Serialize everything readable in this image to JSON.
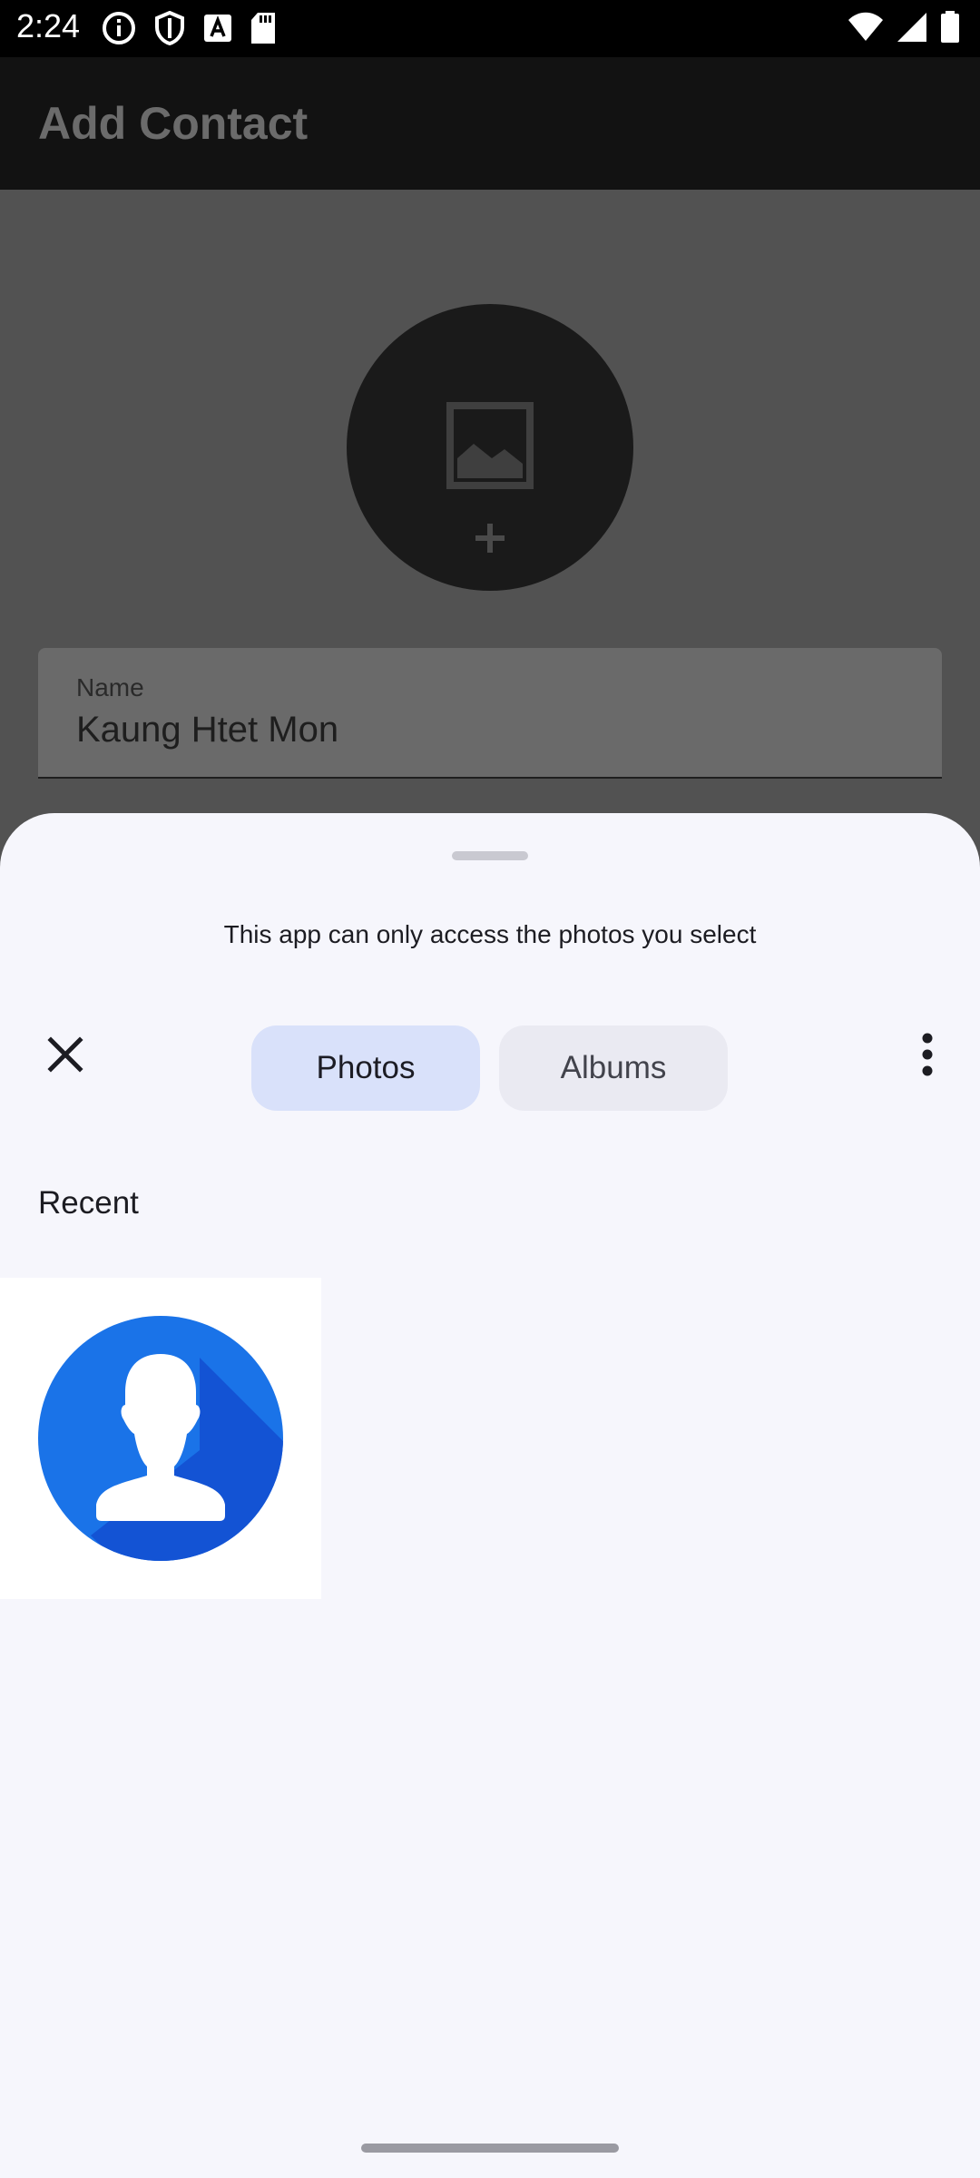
{
  "status_bar": {
    "time": "2:24",
    "left_icons": [
      "info-icon",
      "shield-icon",
      "font-icon",
      "sd-card-icon"
    ],
    "right_icons": [
      "wifi-icon",
      "signal-icon",
      "battery-icon"
    ]
  },
  "app": {
    "title": "Add Contact",
    "name_field": {
      "label": "Name",
      "value": "Kaung Htet Mon"
    }
  },
  "photo_picker": {
    "message": "This app can only access the photos you select",
    "tabs": [
      {
        "label": "Photos",
        "selected": true
      },
      {
        "label": "Albums",
        "selected": false
      }
    ],
    "section_title": "Recent",
    "photos": [
      {
        "icon": "default-avatar-icon",
        "accent": "#1a73e8"
      }
    ]
  },
  "colors": {
    "sheet_background": "#f6f6fc",
    "selected_tab": "#d9e1fa",
    "unselected_tab": "#eaeaf2",
    "avatar_blue": "#1a73e8"
  }
}
